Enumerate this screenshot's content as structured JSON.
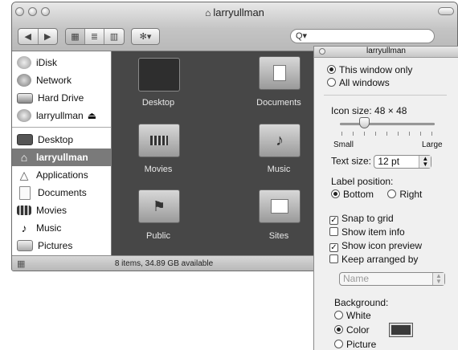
{
  "window": {
    "title": "larryullman",
    "home_icon": "home-icon"
  },
  "toolbar": {
    "back": "◀",
    "forward": "▶",
    "views": [
      "▦",
      "≣",
      "▥"
    ],
    "action": "✻▾",
    "search_prefix": "Q▾"
  },
  "sidebar": {
    "devices": [
      {
        "label": "iDisk",
        "icon": "idisk-icon"
      },
      {
        "label": "Network",
        "icon": "network-icon"
      },
      {
        "label": "Hard Drive",
        "icon": "hard-drive-icon"
      },
      {
        "label": "larryullman",
        "icon": "user-disk-icon",
        "eject": "⏏"
      }
    ],
    "places": [
      {
        "label": "Desktop",
        "icon": "desktop-icon"
      },
      {
        "label": "larryullman",
        "icon": "home-icon"
      },
      {
        "label": "Applications",
        "icon": "applications-icon"
      },
      {
        "label": "Documents",
        "icon": "documents-icon"
      },
      {
        "label": "Movies",
        "icon": "movies-icon"
      },
      {
        "label": "Music",
        "icon": "music-icon"
      },
      {
        "label": "Pictures",
        "icon": "pictures-icon"
      }
    ]
  },
  "folders": [
    {
      "label": "Desktop",
      "icon": "desktop-folder-icon"
    },
    {
      "label": "Documents",
      "icon": "documents-folder-icon"
    },
    {
      "label": "Movies",
      "icon": "movies-folder-icon"
    },
    {
      "label": "Music",
      "icon": "music-folder-icon",
      "glyph": "♪"
    },
    {
      "label": "Public",
      "icon": "public-folder-icon",
      "glyph": "⚑"
    },
    {
      "label": "Sites",
      "icon": "sites-folder-icon"
    }
  ],
  "status": {
    "text": "8 items, 34.89 GB available"
  },
  "view_options": {
    "title": "larryullman",
    "scope": {
      "this_window": "This window only",
      "all_windows": "All windows",
      "selected": "This window only"
    },
    "icon_size": {
      "label": "Icon size:",
      "value": "48 × 48",
      "min_label": "Small",
      "max_label": "Large",
      "level": 0.25
    },
    "text_size": {
      "label": "Text size:",
      "value": "12 pt"
    },
    "label_position": {
      "label": "Label position:",
      "bottom": "Bottom",
      "right": "Right",
      "selected": "Bottom"
    },
    "options": [
      {
        "label": "Snap to grid",
        "checked": true
      },
      {
        "label": "Show item info",
        "checked": false
      },
      {
        "label": "Show icon preview",
        "checked": true
      },
      {
        "label": "Keep arranged by",
        "checked": false
      }
    ],
    "arrange_by": "Name",
    "background": {
      "label": "Background:",
      "white": "White",
      "color": "Color",
      "picture": "Picture",
      "selected": "Color",
      "swatch": "#3a3a3a"
    }
  },
  "colors": {
    "selection": "#7a7a7a",
    "content_bg": "#474747"
  }
}
